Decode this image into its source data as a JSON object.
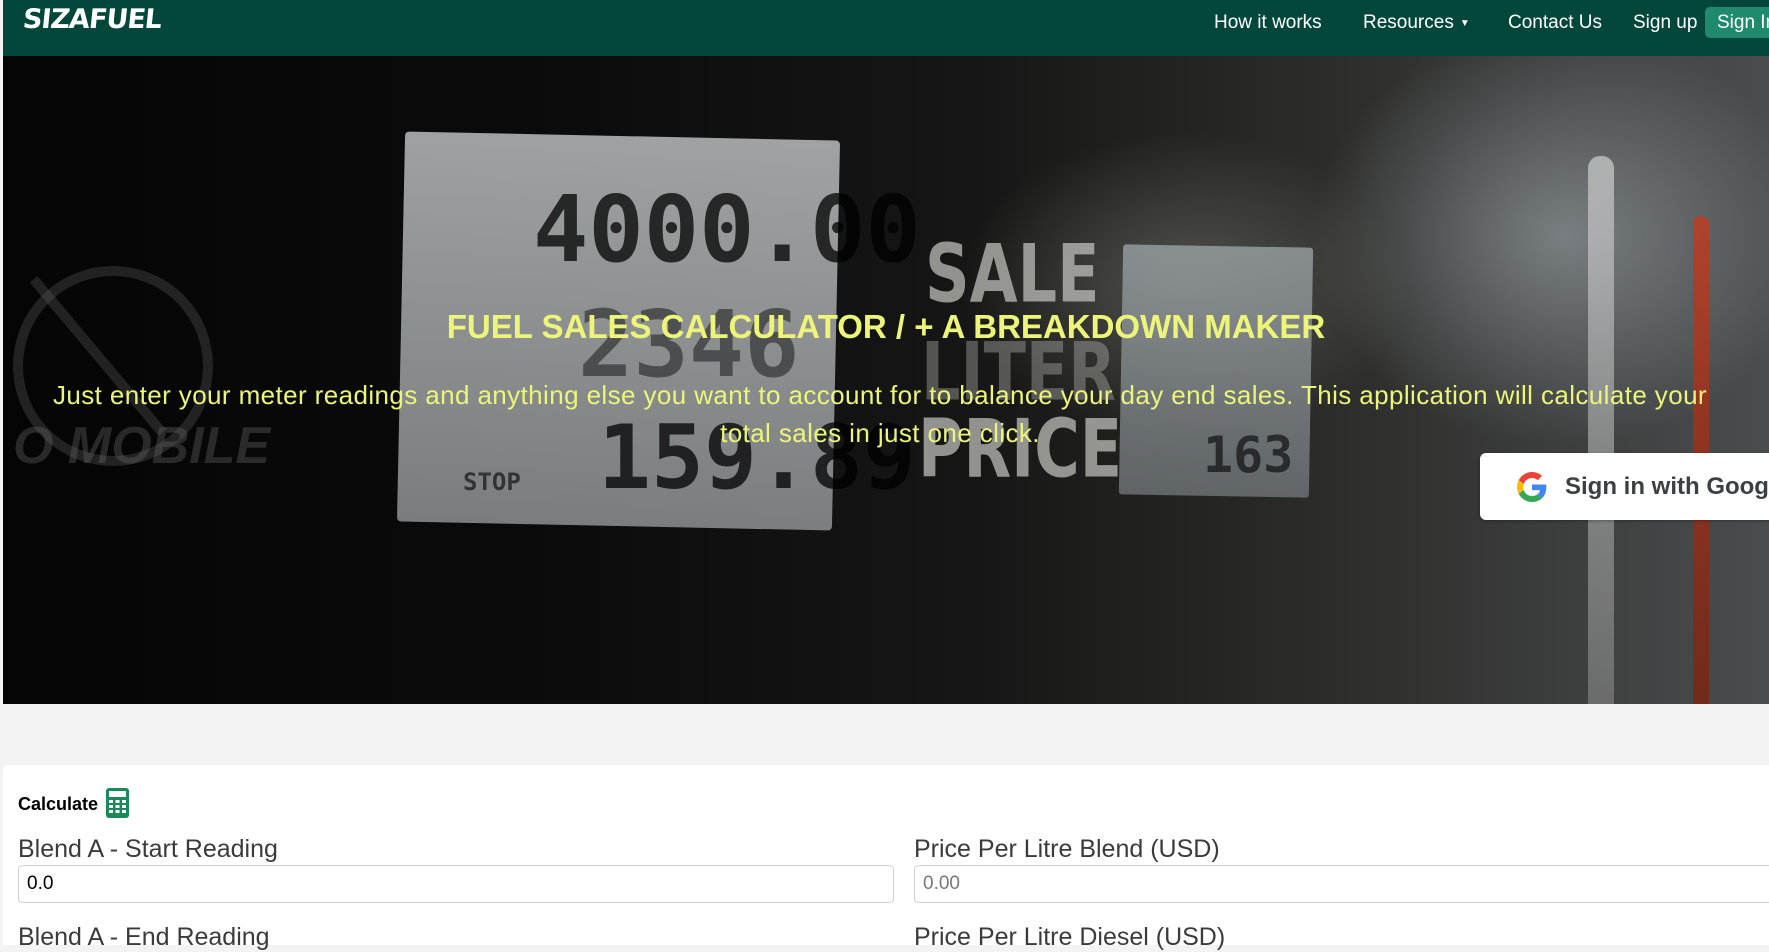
{
  "navbar": {
    "logo": "SIZAFUEL",
    "items": [
      {
        "label": "How it works"
      },
      {
        "label": "Resources",
        "has_dropdown": true
      },
      {
        "label": "Contact Us"
      },
      {
        "label": "Sign up"
      }
    ],
    "signin_label": "Sign In",
    "bg_color": "#03473a",
    "signin_color": "#1f8a6c"
  },
  "hero": {
    "title": "FUEL SALES CALCULATOR / + A BREAKDOWN MAKER",
    "subtitle": "Just enter your meter readings and anything else you want to account for to balance your day end sales. This application will calculate your total sales in just one click.",
    "text_color": "#ecf57a",
    "google_signin": {
      "label": "Sign in with Google",
      "icon": "google-g-icon"
    },
    "background_photo": {
      "display_1": "4000.00",
      "display_2": "2346",
      "display_3": "159.89",
      "sale_text": [
        "SALE",
        "LITER",
        "PRICE"
      ],
      "stop_text": "STOP",
      "display_4": "163"
    }
  },
  "calculator": {
    "title": "Calculate",
    "icon": "calculator-icon",
    "fields": [
      {
        "label": "Blend A - Start Reading",
        "value": "0.0",
        "placeholder": ""
      },
      {
        "label": "Price Per Litre Blend (USD)",
        "value": "",
        "placeholder": "0.00"
      },
      {
        "label": "Blend A - End Reading"
      },
      {
        "label": "Price Per Litre Diesel (USD)"
      }
    ]
  }
}
